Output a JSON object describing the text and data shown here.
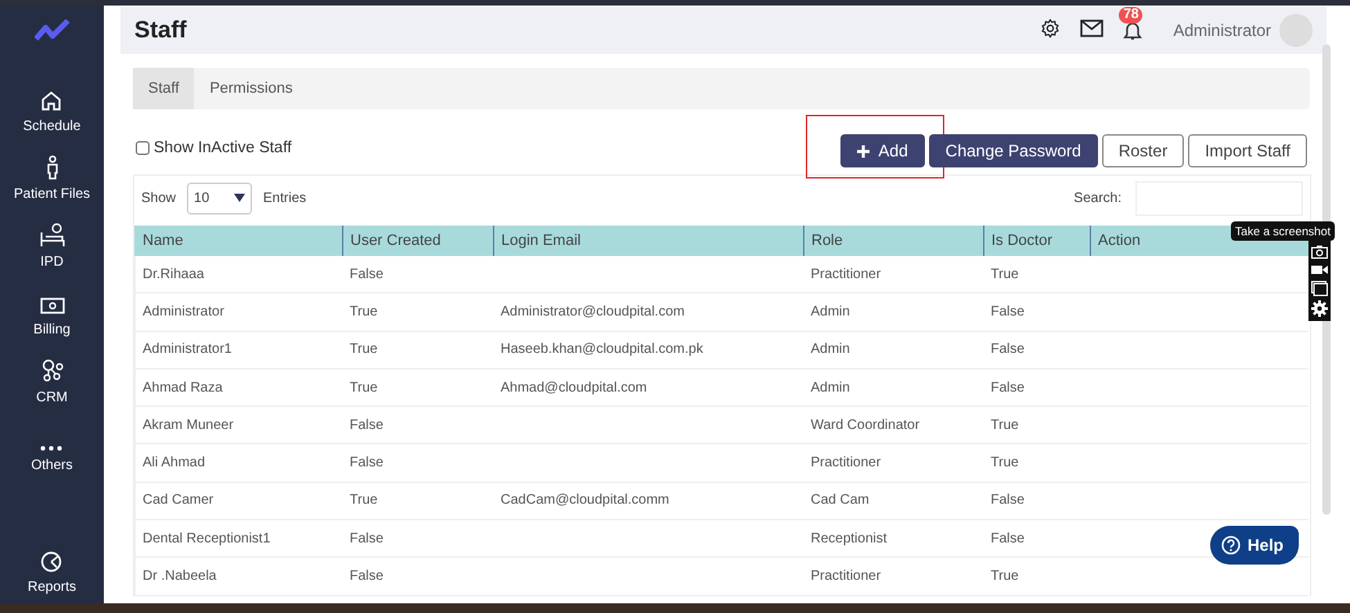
{
  "sidebar": {
    "items": [
      {
        "label": "Schedule"
      },
      {
        "label": "Patient Files"
      },
      {
        "label": "IPD"
      },
      {
        "label": "Billing"
      },
      {
        "label": "CRM"
      },
      {
        "label": "Others"
      }
    ],
    "bottom_item": {
      "label": "Reports"
    }
  },
  "header": {
    "title": "Staff",
    "notification_count": "78",
    "user": "Administrator"
  },
  "tabs": [
    {
      "label": "Staff",
      "selected": true
    },
    {
      "label": "Permissions",
      "selected": false
    }
  ],
  "show_inactive": {
    "label": "Show InActive Staff",
    "checked": false
  },
  "buttons": [
    {
      "label": "Add",
      "kind": "primary",
      "highlighted": true
    },
    {
      "label": "Change Password",
      "kind": "primary",
      "highlighted": false
    },
    {
      "label": "Roster",
      "kind": "outline",
      "highlighted": false
    },
    {
      "label": "Import Staff",
      "kind": "outline",
      "highlighted": false
    }
  ],
  "length": {
    "before": "Show",
    "value": "10",
    "after": "Entries"
  },
  "search": {
    "label": "Search:"
  },
  "table": {
    "columns": [
      "Name",
      "User Created",
      "Login Email",
      "Role",
      "Is Doctor",
      "Action"
    ],
    "rows": [
      [
        "Dr.Rihaaa",
        "False",
        "",
        "Practitioner",
        "True",
        ""
      ],
      [
        "Administrator",
        "True",
        "Administrator@cloudpital.com",
        "Admin",
        "False",
        ""
      ],
      [
        "Administrator1",
        "True",
        "Haseeb.khan@cloudpital.com.pk",
        "Admin",
        "False",
        ""
      ],
      [
        "Ahmad Raza",
        "True",
        "Ahmad@cloudpital.com",
        "Admin",
        "False",
        ""
      ],
      [
        "Akram Muneer",
        "False",
        "",
        "Ward Coordinator",
        "True",
        ""
      ],
      [
        "Ali Ahmad",
        "False",
        "",
        "Practitioner",
        "True",
        ""
      ],
      [
        "Cad Camer",
        "True",
        "CadCam@cloudpital.comm",
        "Cad Cam",
        "False",
        ""
      ],
      [
        "Dental Receptionist1",
        "False",
        "",
        "Receptionist",
        "False",
        ""
      ],
      [
        "Dr .Nabeela",
        "False",
        "",
        "Practitioner",
        "True",
        ""
      ]
    ]
  },
  "help": {
    "label": "Help"
  },
  "screenshot_tool": {
    "tooltip": "Take a screenshot"
  }
}
